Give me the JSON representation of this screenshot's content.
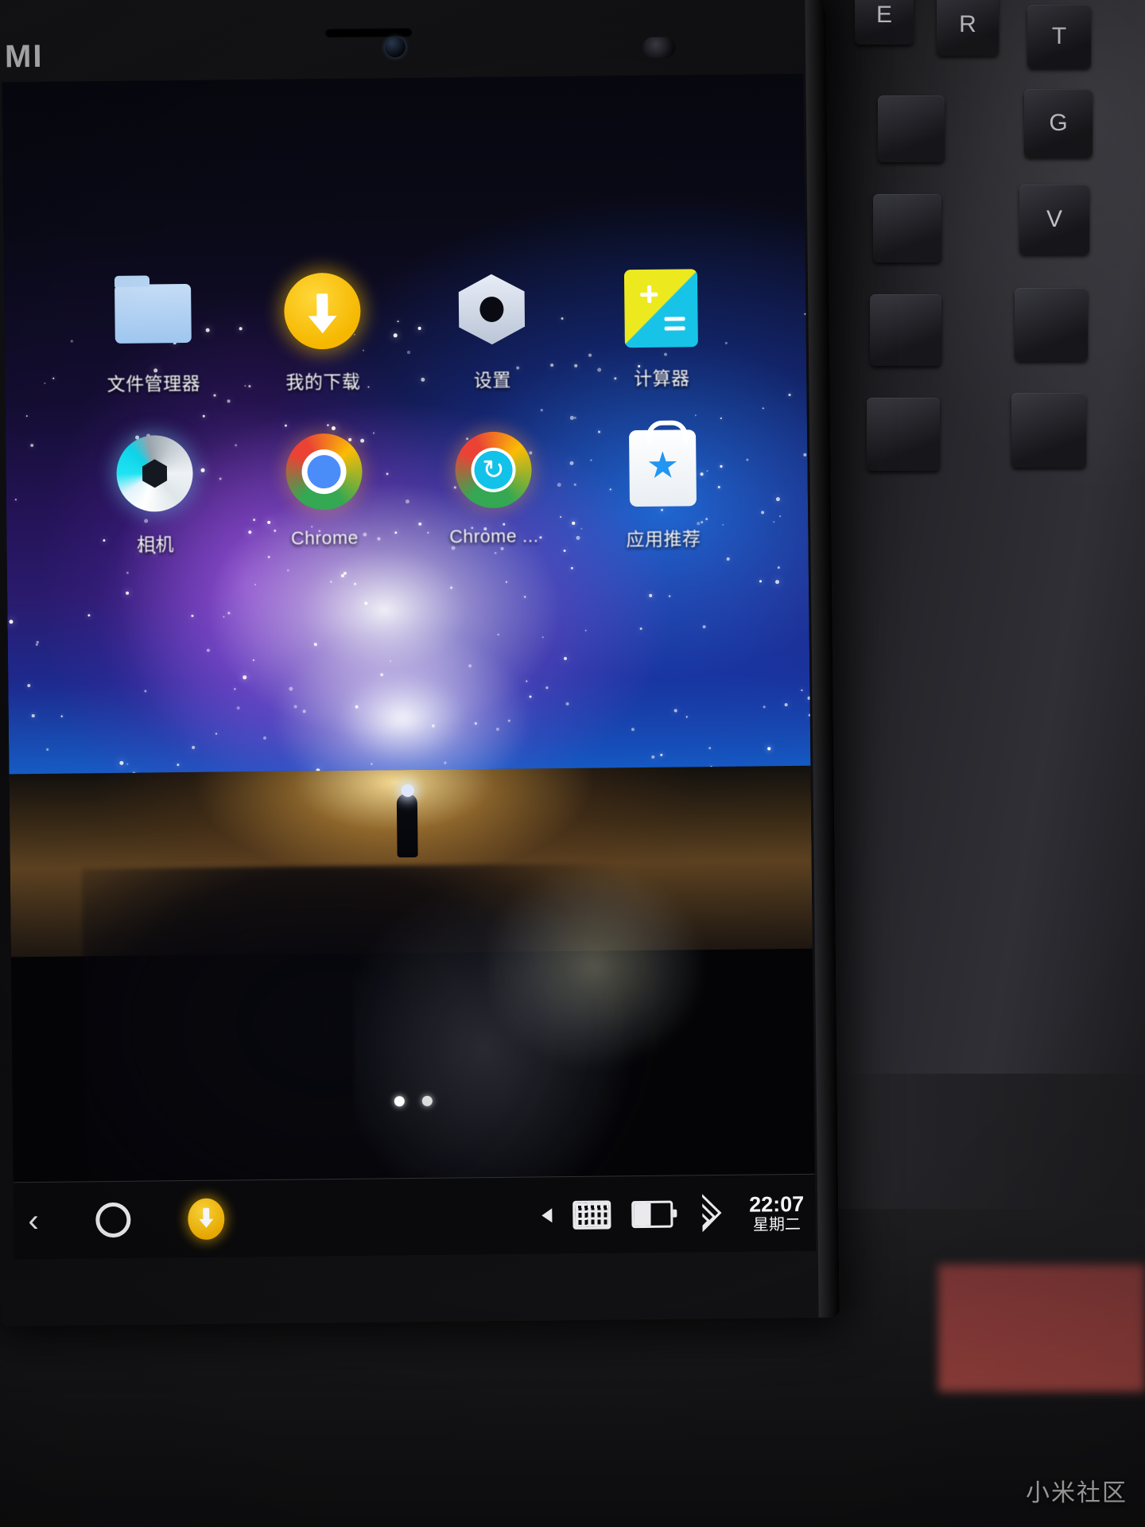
{
  "device": {
    "brand_logo": "MI",
    "watermark": "小米社区"
  },
  "keyboard": {
    "keys": [
      {
        "label": "E"
      },
      {
        "label": "R"
      },
      {
        "label": "T"
      },
      {
        "label": "G"
      },
      {
        "label": "V"
      }
    ]
  },
  "home": {
    "rows": [
      {
        "apps": [
          {
            "label": "文件管理器",
            "icon": "folder-icon"
          },
          {
            "label": "我的下载",
            "icon": "download-circle-icon"
          },
          {
            "label": "设置",
            "icon": "settings-hex-icon"
          },
          {
            "label": "计算器",
            "icon": "calculator-icon"
          }
        ]
      },
      {
        "apps": [
          {
            "label": "相机",
            "icon": "camera-icon"
          },
          {
            "label": "Chrome",
            "icon": "chrome-icon"
          },
          {
            "label": "Chrome ...",
            "icon": "chrome-sync-icon"
          },
          {
            "label": "应用推荐",
            "icon": "app-store-bag-icon"
          }
        ]
      }
    ],
    "page_dots": {
      "count": 2,
      "active_index": 0
    }
  },
  "navbar": {
    "back_glyph": "‹",
    "home_icon": "home-circle-icon",
    "download_icon": "download-status-icon",
    "play_icon": "play-triangle-icon",
    "keyboard_icon": "keyboard-icon",
    "battery_icon": "battery-icon",
    "wifi_icon": "wifi-icon",
    "clock_time": "22:07",
    "clock_day": "星期二"
  },
  "colors": {
    "accent_yellow": "#f5b700",
    "chrome_blue": "#4b8df8",
    "calc_yellow": "#ecea1f",
    "calc_cyan": "#17c4e8",
    "folder_blue": "#9ec6ef",
    "navbar_bg": "#0a0a0c"
  }
}
